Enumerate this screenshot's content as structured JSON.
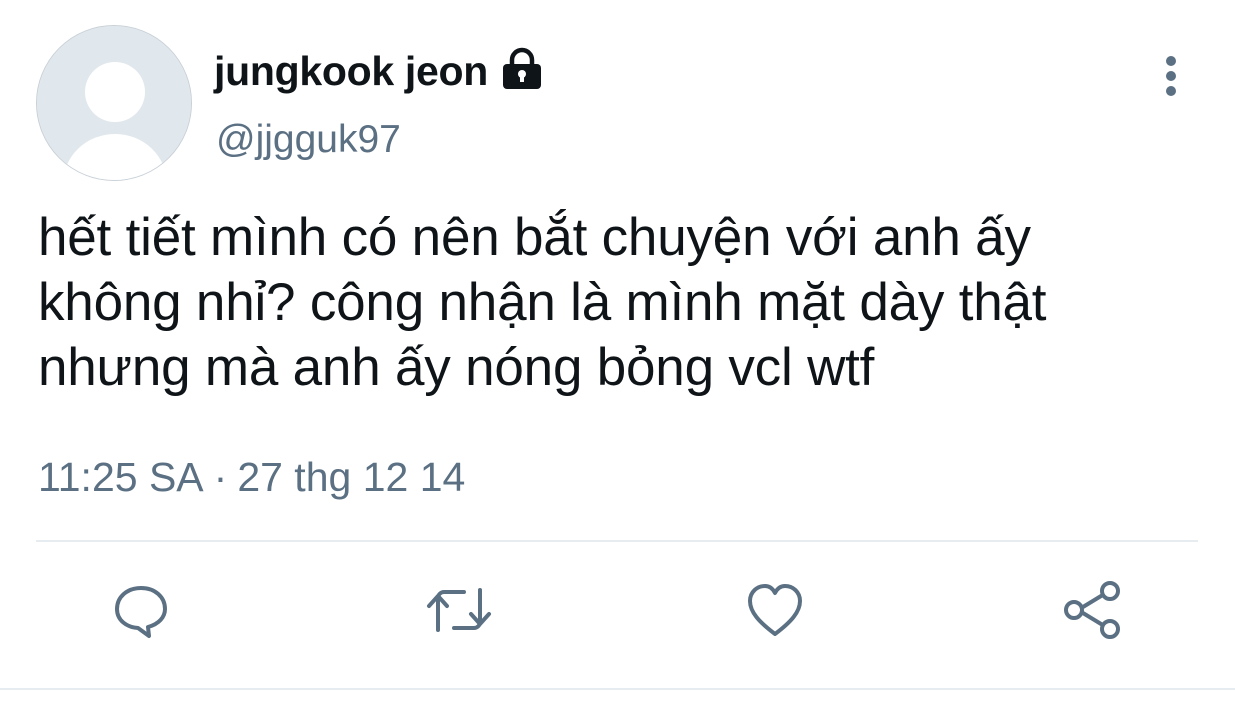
{
  "tweet": {
    "display_name": "jungkook jeon",
    "handle": "@jjgguk97",
    "text_lines": [
      "hết tiết mình có nên bắt chuyện với anh ấy",
      "không nhỉ? công nhận là mình mặt dày thật",
      "nhưng mà anh ấy nóng bỏng vcl wtf"
    ],
    "time": "11:25 SA",
    "separator": "·",
    "date": "27 thg 12 14"
  },
  "icons": {
    "protected": "lock-icon",
    "more": "more-vertical-icon",
    "reply": "reply-icon",
    "retweet": "retweet-icon",
    "like": "heart-icon",
    "share": "share-icon"
  },
  "colors": {
    "text": "#0f1419",
    "secondary": "#5b7083",
    "divider": "#e6ecf0",
    "avatar_bg": "#e1e8ed"
  }
}
